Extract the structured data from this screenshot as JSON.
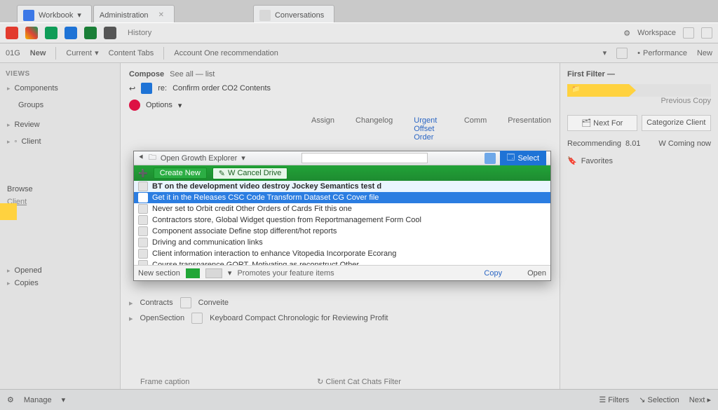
{
  "tabs": [
    {
      "label": "Workbook"
    },
    {
      "label": "Administration"
    },
    {
      "label": "Conversations"
    }
  ],
  "appbar": {
    "history": "History",
    "right_label": "Workspace"
  },
  "ribbon": {
    "items": [
      "01G",
      "New",
      "Current",
      "Content Tabs",
      "Account One recommendation"
    ],
    "right": [
      "Performance",
      "New"
    ]
  },
  "left": {
    "title": "Views",
    "items": [
      "Components",
      "Groups",
      "Review",
      "Client"
    ],
    "lower": [
      "Browse",
      "Client",
      "Opened",
      "Copies"
    ]
  },
  "mid": {
    "section": "Compose",
    "subject_prefix": "re:",
    "subject": "Confirm order CO2 Contents",
    "options": "Options",
    "tabs": [
      "Assign",
      "Changelog",
      "Urgent Offset Order",
      "Comm",
      "Presentation"
    ]
  },
  "dialog": {
    "breadcrumb": "Open Growth  Explorer",
    "search_placeholder": "",
    "select_btn": "Select",
    "toolbar": {
      "btn1": "Create New",
      "btn2": "W Cancel Drive"
    },
    "rows": [
      "BT on the development video destroy Jockey Semantics test d",
      "Get it in the Releases   CSC Code Transform Dataset           CG  Cover file",
      "Never set to Orbit credit  Other Orders of Cards Fit this one",
      "Contractors store, Global  Widget question from Reportmanagement   Form Cool",
      "Component associate Define stop different/hot reports",
      "Driving and communication links",
      "Client information interaction to enhance Vitopedia Incorporate Ecorang",
      "Course transparence  GORT, Motivating as reconstruct Other."
    ],
    "status_left": "New section",
    "status_link": "Copy",
    "status_right": "Open",
    "status_hint": "Promotes your feature items"
  },
  "mid_under": {
    "r1a": "Contracts",
    "r1b": "Conveite",
    "r2a": "OpenSection",
    "r2b": "Keyboard Compact Chronologic for Reviewing Profit"
  },
  "right": {
    "header": "First  Filter —",
    "toolbar_hint": "Previous  Copy",
    "btn1": "Next For",
    "btn2": "Categorize Client",
    "row_a": "Recommending",
    "row_a_val": "8.01",
    "row_b": "W Coming now",
    "row_c": "Favorites"
  },
  "footer_left": "Frame caption",
  "footer_center": "Client Cat Chats Filter",
  "status": {
    "left": "Manage",
    "mid": "",
    "r1": "Filters",
    "r2": "Selection",
    "r3": "Next"
  },
  "colors": {
    "blue": "#1e73d6",
    "green": "#22a338",
    "yellow": "#ffd23f"
  }
}
